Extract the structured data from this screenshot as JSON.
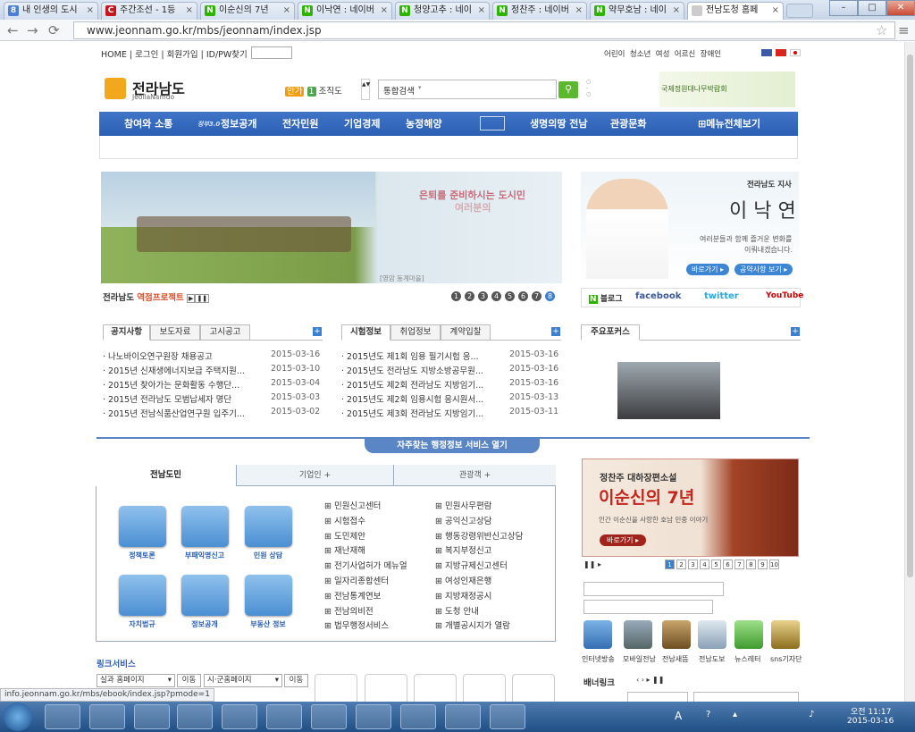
{
  "browser": {
    "tabs": [
      {
        "label": "내 인생의 도시",
        "fav": "8",
        "color": "#4a7ed8"
      },
      {
        "label": "주간조선 - 1등",
        "fav": "C",
        "color": "#c4161c"
      },
      {
        "label": "이순신의 7년",
        "fav": "N",
        "color": "#2db400"
      },
      {
        "label": "이낙연 : 네이버",
        "fav": "N",
        "color": "#2db400"
      },
      {
        "label": "청양고추 : 네이",
        "fav": "N",
        "color": "#2db400"
      },
      {
        "label": "정찬주 : 네이버",
        "fav": "N",
        "color": "#2db400"
      },
      {
        "label": "약무호남 : 네이",
        "fav": "N",
        "color": "#2db400"
      },
      {
        "label": "전남도청 홈페",
        "fav": "",
        "color": "#cccccc"
      }
    ],
    "url": "www.jeonnam.go.kr/mbs/jeonnam/index.jsp",
    "status_url": "info.jeonnam.go.kr/mbs/ebook/index.jsp?pmode=1"
  },
  "util": {
    "links": [
      "HOME",
      "로그인",
      "회원가입",
      "ID/PW찾기"
    ],
    "right": [
      "어린이",
      "청소년",
      "여성",
      "어르신",
      "장애인"
    ]
  },
  "logo": {
    "main": "전라남도",
    "sub": "JeollaNamdo"
  },
  "org": {
    "badge1": "안가",
    "badge2": "1",
    "label": "조직도"
  },
  "search": {
    "select": "통합검색",
    "placeholder": ""
  },
  "expo": "국제정원대나무박람회",
  "gnb": [
    "참여와 소통",
    "정보공개",
    "전자민원",
    "기업경제",
    "농정해양",
    "생명의땅 전남",
    "관광문화",
    "메뉴전체보기"
  ],
  "gnb_prefix": "정부3.0",
  "hero": {
    "text1": "은퇴를 준비하시는 도시민",
    "text2": "여러분의",
    "caption": "[영암 동계마을]",
    "project_a": "전라남도",
    "project_b": "역점프로젝트",
    "pages": [
      "1",
      "2",
      "3",
      "4",
      "5",
      "6",
      "7",
      "8"
    ]
  },
  "gov": {
    "title": "전라남도 지사",
    "name": "이 낙 연",
    "msg1": "여러분들과 함께 즐거운 변화를",
    "msg2": "이뤄내겠습니다.",
    "btn1": "바로가기 ▸",
    "btn2": "공약사항 보기 ▸"
  },
  "sns": [
    "블로그",
    "facebook",
    "twitter",
    "YouTube"
  ],
  "notice": {
    "tabs": [
      "공지사항",
      "보도자료",
      "고시공고"
    ],
    "items": [
      {
        "t": "나노바이오연구원장 채용공고",
        "d": "2015-03-16"
      },
      {
        "t": "2015년 신재생에너지보급 주택지원...",
        "d": "2015-03-10"
      },
      {
        "t": "2015년 찾아가는 문화활동 수행단...",
        "d": "2015-03-04"
      },
      {
        "t": "2015년 전라남도 모범납세자 명단",
        "d": "2015-03-03"
      },
      {
        "t": "2015년 전남식품산업연구원 입주기...",
        "d": "2015-03-02"
      }
    ]
  },
  "exam": {
    "tabs": [
      "시험정보",
      "취업정보",
      "계약입찰"
    ],
    "items": [
      {
        "t": "2015년도 제1회 임용 필기시험 응...",
        "d": "2015-03-16"
      },
      {
        "t": "2015년도 전라남도 지방소방공무원...",
        "d": "2015-03-16"
      },
      {
        "t": "2015년도 제2회 전라남도 지방임기...",
        "d": "2015-03-16"
      },
      {
        "t": "2015년도 제2회 임용시험 응시원서...",
        "d": "2015-03-13"
      },
      {
        "t": "2015년도 제3회 전라남도 지방임기...",
        "d": "2015-03-11"
      }
    ]
  },
  "focus": {
    "tab": "주요포커스"
  },
  "service_bar": "자주찾는 행정정보 서비스 열기",
  "citizen": {
    "tabs": [
      "전남도민",
      "기업인 +",
      "관광객 +"
    ],
    "icons": [
      "정책토론",
      "부패익명신고",
      "민원 상담",
      "자치법규",
      "정보공개",
      "부동산 정보"
    ],
    "links_a": [
      "민원신고센터",
      "시험접수",
      "도민제안",
      "재난재해",
      "전기사업허가 메뉴얼",
      "일자리종합센터",
      "전남통계연보",
      "전남의비전",
      "법무행정서비스"
    ],
    "links_b": [
      "민원사무편람",
      "공익신고상담",
      "행동강령위반신고상담",
      "복지부정신고",
      "지방규제신고센터",
      "여성인재은행",
      "지방재정공시",
      "도청 안내",
      "개별공시지가 열람"
    ]
  },
  "banner": {
    "line1": "정찬주 대하장편소설",
    "line2": "이순신의 7년",
    "line3": "인간 이순신을 사랑한 호남 민중 이야기",
    "btn": "바로가기 ▸",
    "pages": [
      "1",
      "2",
      "3",
      "4",
      "5",
      "6",
      "7",
      "8",
      "9",
      "10"
    ]
  },
  "icons_right": [
    "인터넷방송",
    "모바일전남",
    "전남새뜸",
    "전남도보",
    "뉴스레터",
    "sns기자단"
  ],
  "linkservice": {
    "title": "링크서비스",
    "sel1": "실과 홈페이지",
    "go1": "이동",
    "sel2": "시·군홈페이지",
    "go2": "이동"
  },
  "bannerlink": "배너링크",
  "taskbar": {
    "ime": "A",
    "time": "오전 11:17",
    "date": "2015-03-16"
  }
}
